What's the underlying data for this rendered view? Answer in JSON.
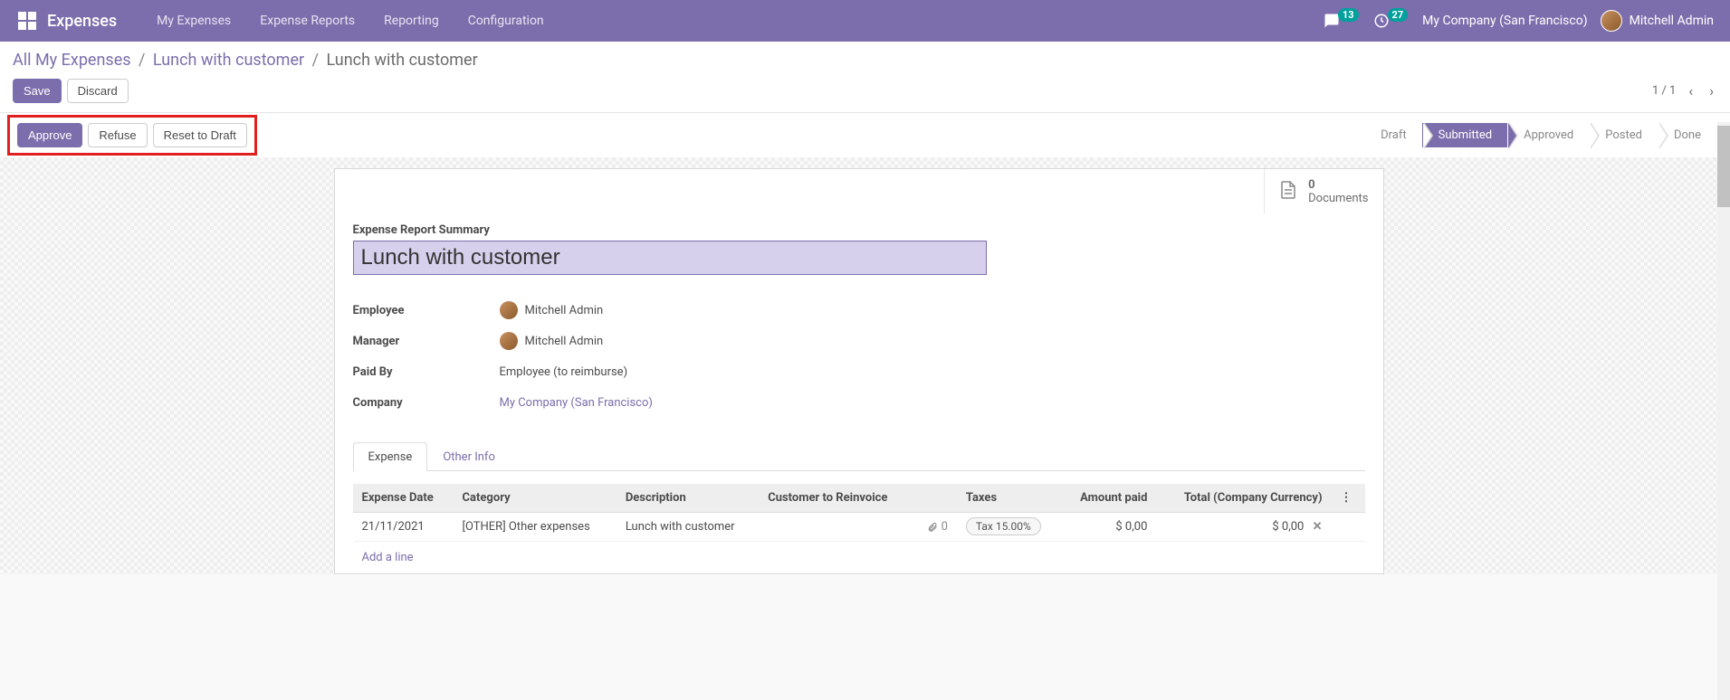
{
  "navbar": {
    "brand": "Expenses",
    "links": [
      "My Expenses",
      "Expense Reports",
      "Reporting",
      "Configuration"
    ],
    "msg_badge": "13",
    "activity_badge": "27",
    "company": "My Company (San Francisco)",
    "user": "Mitchell Admin"
  },
  "breadcrumb": {
    "root": "All My Expenses",
    "mid": "Lunch with customer",
    "current": "Lunch with customer"
  },
  "controls": {
    "save": "Save",
    "discard": "Discard",
    "pager": "1 / 1"
  },
  "status_actions": {
    "approve": "Approve",
    "refuse": "Refuse",
    "reset": "Reset to Draft"
  },
  "status_steps": [
    "Draft",
    "Submitted",
    "Approved",
    "Posted",
    "Done"
  ],
  "status_active_index": 1,
  "documents": {
    "count": "0",
    "label": "Documents"
  },
  "form": {
    "summary_label": "Expense Report Summary",
    "summary_value": "Lunch with customer",
    "employee_label": "Employee",
    "employee_value": "Mitchell Admin",
    "manager_label": "Manager",
    "manager_value": "Mitchell Admin",
    "paidby_label": "Paid By",
    "paidby_value": "Employee (to reimburse)",
    "company_label": "Company",
    "company_value": "My Company (San Francisco)"
  },
  "tabs": {
    "expense": "Expense",
    "other": "Other Info"
  },
  "table": {
    "headers": {
      "date": "Expense Date",
      "category": "Category",
      "description": "Description",
      "customer": "Customer to Reinvoice",
      "taxes": "Taxes",
      "amount": "Amount paid",
      "total": "Total (Company Currency)"
    },
    "row": {
      "date": "21/11/2021",
      "category": "[OTHER] Other expenses",
      "description": "Lunch with customer",
      "customer": "",
      "attach_count": "0",
      "tax": "Tax 15.00%",
      "amount": "$ 0,00",
      "total": "$ 0,00"
    },
    "add_line": "Add a line"
  }
}
